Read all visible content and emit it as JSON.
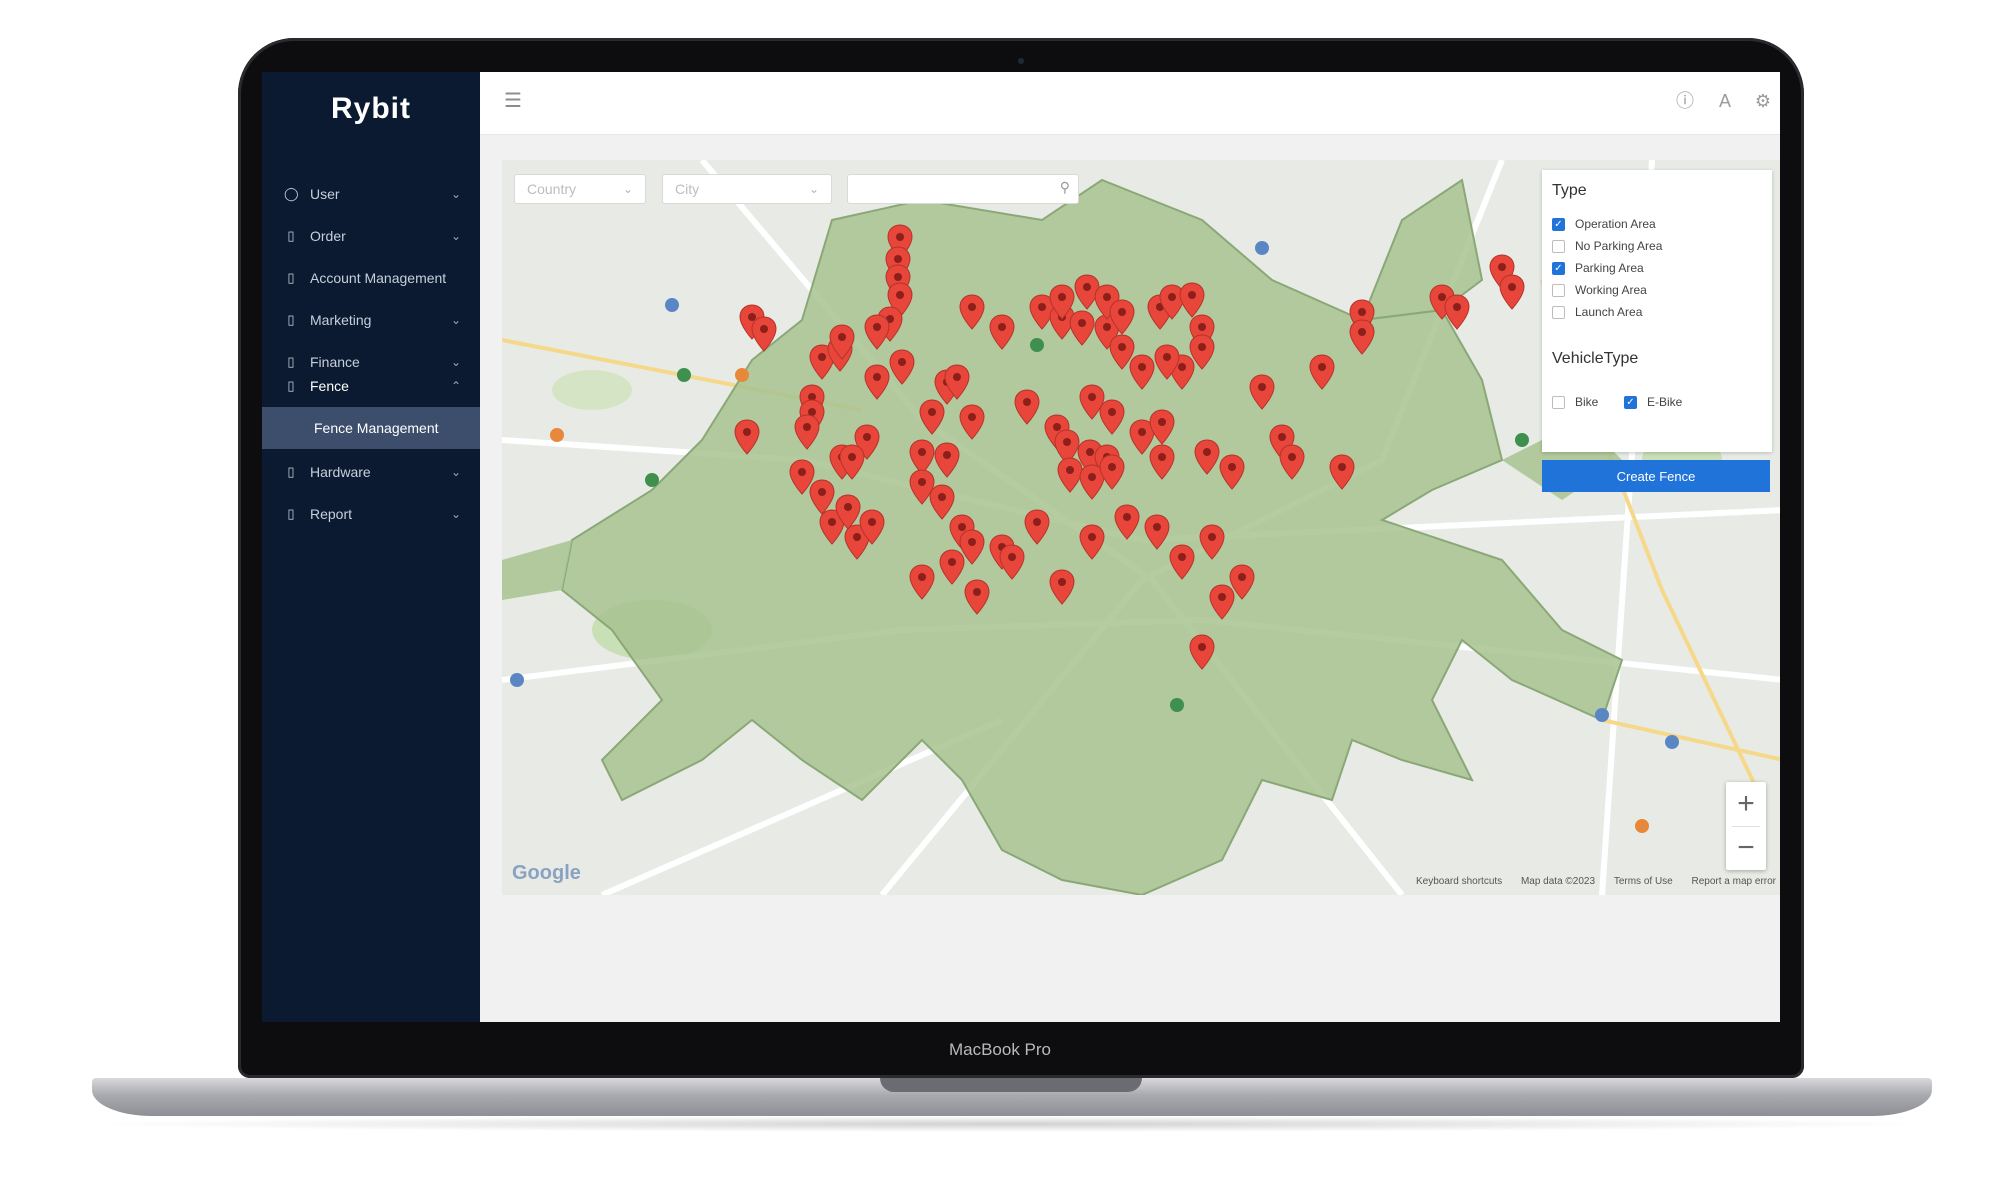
{
  "device": {
    "model": "MacBook Pro"
  },
  "sidebar": {
    "logo": "Rybit",
    "items": [
      {
        "label": "User",
        "icon": "user-icon",
        "expandable": true
      },
      {
        "label": "Order",
        "icon": "document-icon",
        "expandable": true
      },
      {
        "label": "Account Management",
        "icon": "document-icon",
        "expandable": false
      },
      {
        "label": "Marketing",
        "icon": "document-icon",
        "expandable": true
      },
      {
        "label": "Finance",
        "icon": "document-icon",
        "expandable": true
      },
      {
        "label": "Fence",
        "icon": "document-icon",
        "expandable": true,
        "expanded": true
      },
      {
        "label": "Hardware",
        "icon": "document-icon",
        "expandable": true
      },
      {
        "label": "Report",
        "icon": "document-icon",
        "expandable": true
      }
    ],
    "sub_item": "Fence Management"
  },
  "topbar": {
    "menu_icon": "menu-toggle-icon",
    "right_icons": [
      "help-icon",
      "font-size-icon",
      "settings-icon"
    ]
  },
  "filters": {
    "country_placeholder": "Country",
    "city_placeholder": "City",
    "search_value": ""
  },
  "panel": {
    "type_title": "Type",
    "types": [
      {
        "label": "Operation Area",
        "checked": true
      },
      {
        "label": "No Parking Area",
        "checked": false
      },
      {
        "label": "Parking Area",
        "checked": true
      },
      {
        "label": "Working Area",
        "checked": false
      },
      {
        "label": "Launch Area",
        "checked": false
      }
    ],
    "vehicle_title": "VehicleType",
    "vehicles": [
      {
        "label": "Bike",
        "checked": false
      },
      {
        "label": "E-Bike",
        "checked": true
      }
    ],
    "create_button": "Create Fence"
  },
  "map": {
    "provider_mark": "Google",
    "footer": [
      "Keyboard shortcuts",
      "Map data ©2023",
      "Terms of Use",
      "Report a map error"
    ],
    "zoom_in": "+",
    "zoom_out": "−",
    "fence_color": "#a7c38f",
    "pin_color": "#e8463a"
  }
}
